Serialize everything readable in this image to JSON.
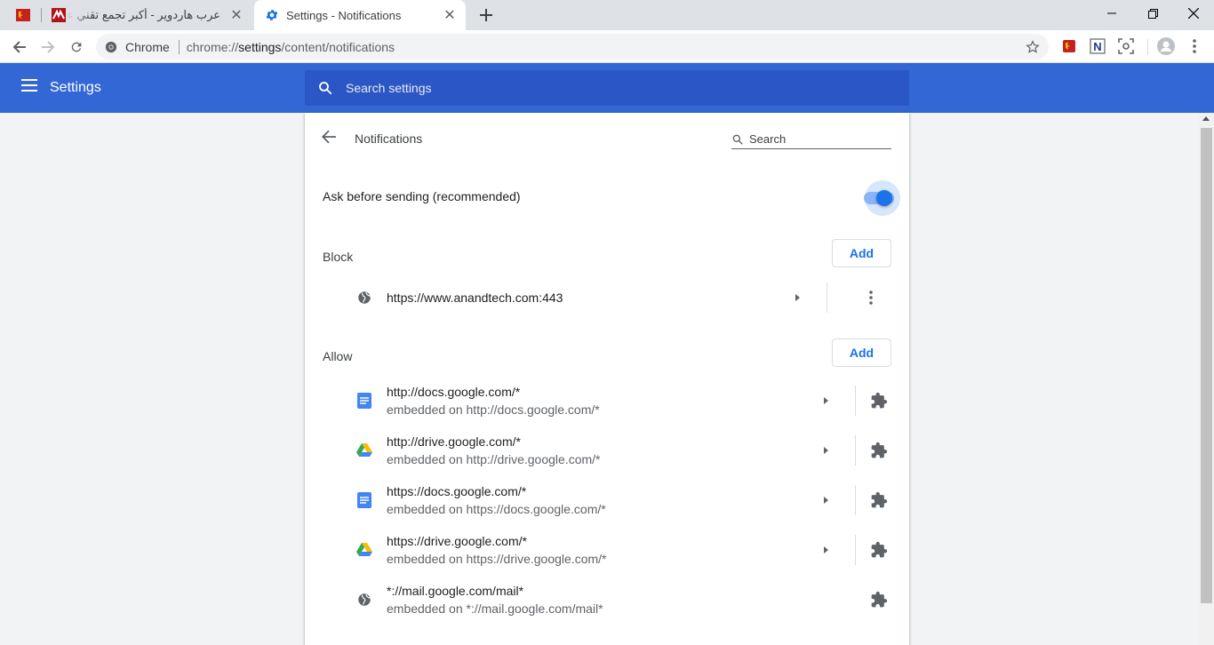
{
  "tabs": [
    {
      "title": "",
      "icon": "red-flag-favicon"
    },
    {
      "title": "عرب هاردوير - أكبر تجمع تقني عربي",
      "icon": "arabhardware-favicon"
    },
    {
      "title": "Settings - Notifications",
      "icon": "gear-icon",
      "active": true
    }
  ],
  "omnibox": {
    "chip_label": "Chrome",
    "url_scheme": "chrome://",
    "url_host": "settings",
    "url_path": "/content/notifications"
  },
  "header": {
    "title": "Settings",
    "search_placeholder": "Search settings"
  },
  "page": {
    "title": "Notifications",
    "search_label": "Search",
    "ask_label": "Ask before sending (recommended)",
    "ask_enabled": true,
    "block": {
      "label": "Block",
      "add_label": "Add",
      "sites": [
        {
          "url": "https://www.anandtech.com:443"
        }
      ]
    },
    "allow": {
      "label": "Allow",
      "add_label": "Add",
      "sites": [
        {
          "url": "http://docs.google.com/*",
          "embedded": "embedded on http://docs.google.com/*",
          "icon": "google-docs-icon"
        },
        {
          "url": "http://drive.google.com/*",
          "embedded": "embedded on http://drive.google.com/*",
          "icon": "google-drive-icon"
        },
        {
          "url": "https://docs.google.com/*",
          "embedded": "embedded on https://docs.google.com/*",
          "icon": "google-docs-icon"
        },
        {
          "url": "https://drive.google.com/*",
          "embedded": "embedded on https://drive.google.com/*",
          "icon": "google-drive-icon"
        },
        {
          "url": "*://mail.google.com/mail*",
          "embedded": "embedded on *://mail.google.com/mail*",
          "icon": "globe-icon"
        }
      ]
    }
  },
  "colors": {
    "accent": "#3367d6",
    "accent_dark": "#2a56c6",
    "link": "#1a73e8"
  }
}
